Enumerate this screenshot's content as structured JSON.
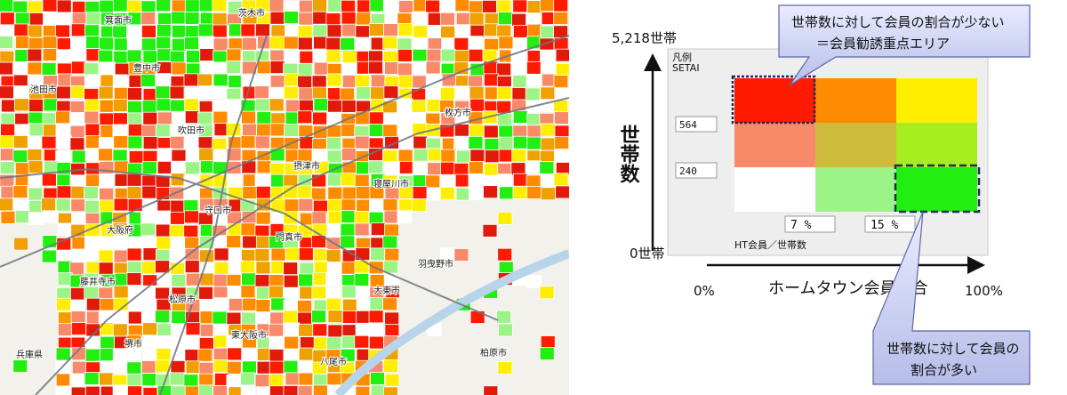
{
  "map": {
    "labels": [
      "箕面市",
      "茨木市",
      "池田市",
      "豊中市",
      "吹田市",
      "摂津市",
      "寝屋川市",
      "枚方市",
      "守口市",
      "門真市",
      "大阪府",
      "兵庫県",
      "大東市",
      "東大阪市",
      "八尾市",
      "堺市",
      "松原市",
      "藤井寺市",
      "羽曳野市",
      "柏原市"
    ]
  },
  "legend": {
    "title": "凡例",
    "field": "SETAI",
    "y_thresholds": [
      "564",
      "240"
    ],
    "x_thresholds": [
      "7 %",
      "15 %"
    ],
    "x_field": "HT会員／世帯数",
    "cell_colors": [
      [
        "#ff1a00",
        "#ff8c00",
        "#ffee00"
      ],
      [
        "#f88a6a",
        "#cdbb3a",
        "#a6ee1e"
      ],
      [
        "#ffffff",
        "#9cf486",
        "#22ee11"
      ]
    ]
  },
  "axes": {
    "y_max": "5,218世帯",
    "y_min": "0世帯",
    "y_title": "世帯数",
    "x_min": "0%",
    "x_max": "100%",
    "x_title": "ホームタウン会員割合"
  },
  "callouts": {
    "top_line1": "世帯数に対して会員の割合が少ない",
    "top_line2": "＝会員勧誘重点エリア",
    "bottom_line1": "世帯数に対して会員の",
    "bottom_line2": "割合が多い"
  }
}
